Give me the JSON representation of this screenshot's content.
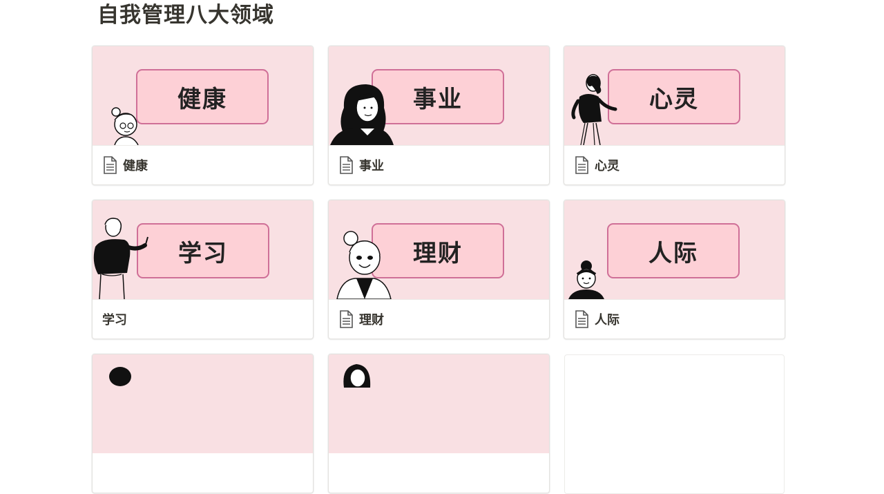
{
  "page": {
    "title": "自我管理八大领域"
  },
  "cards": [
    {
      "label": "健康",
      "title": "健康",
      "has_icon": true,
      "figure": "woman-with-bun-glasses"
    },
    {
      "label": "事业",
      "title": "事业",
      "has_icon": true,
      "figure": "woman-long-hair"
    },
    {
      "label": "心灵",
      "title": "心灵",
      "has_icon": true,
      "figure": "woman-walking-pointing"
    },
    {
      "label": "学习",
      "title": "学习",
      "has_icon": false,
      "figure": "woman-pointing-up"
    },
    {
      "label": "理财",
      "title": "理财",
      "has_icon": true,
      "figure": "woman-bun-happy"
    },
    {
      "label": "人际",
      "title": "人际",
      "has_icon": true,
      "figure": "girl-with-headband"
    }
  ],
  "colors": {
    "cover_bg": "#f9e0e3",
    "tag_bg": "#fdd0d6",
    "tag_border": "#cf6f97",
    "text": "#37352f"
  },
  "icons": {
    "page": "page-document-icon"
  }
}
